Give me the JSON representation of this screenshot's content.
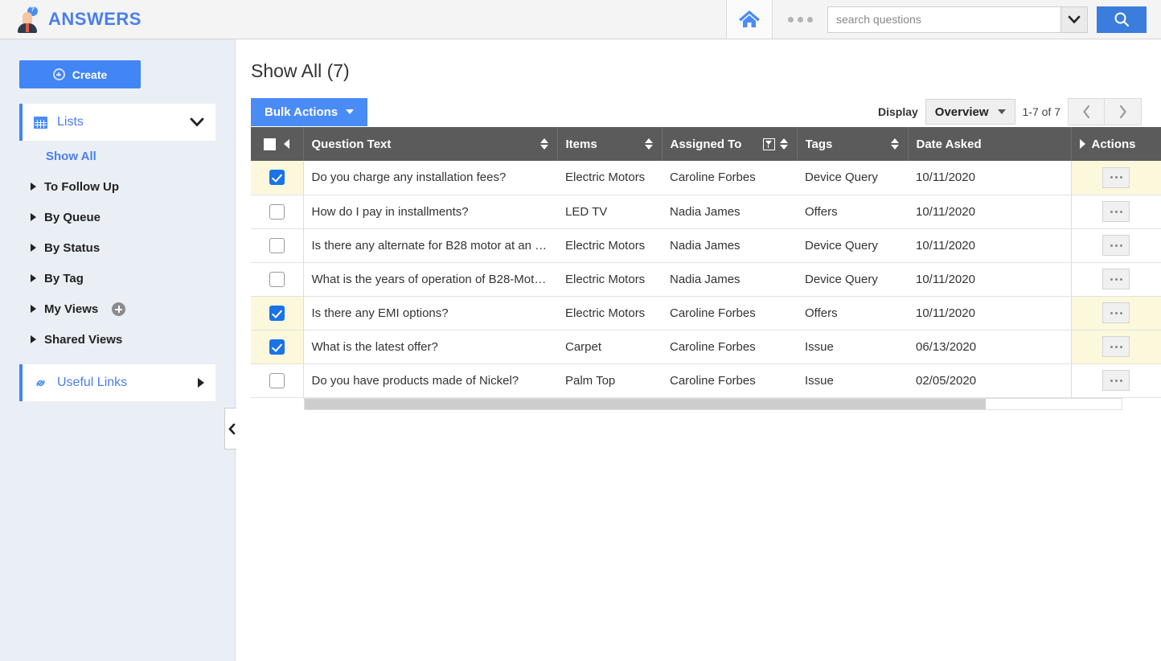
{
  "app": {
    "brand": "ANSWERS",
    "logo_icon": "person-question-icon"
  },
  "topbar": {
    "home_icon": "home-icon",
    "more_icon": "ellipsis-icon",
    "search": {
      "placeholder": "search questions",
      "value": "",
      "dropdown_icon": "chevron-down-icon",
      "submit_icon": "search-icon"
    }
  },
  "sidebar": {
    "create_label": "Create",
    "create_icon": "plus-circle-icon",
    "section": {
      "label": "Lists",
      "icon": "grid-icon",
      "expand_icon": "chevron-down-icon"
    },
    "items": [
      {
        "label": "Show All",
        "current": true,
        "icon": ""
      },
      {
        "label": "To Follow Up",
        "current": false,
        "icon": "chevron-right-icon"
      },
      {
        "label": "By Queue",
        "current": false,
        "icon": "chevron-right-icon"
      },
      {
        "label": "By Status",
        "current": false,
        "icon": "chevron-right-icon"
      },
      {
        "label": "By Tag",
        "current": false,
        "icon": "chevron-right-icon"
      },
      {
        "label": "My Views",
        "current": false,
        "icon": "chevron-right-icon",
        "add_icon": "add-circle-icon"
      },
      {
        "label": "Shared Views",
        "current": false,
        "icon": "chevron-right-icon"
      }
    ],
    "useful_links": {
      "label": "Useful Links",
      "icon": "link-icon",
      "expand_icon": "chevron-right-icon"
    },
    "collapse_icon": "chevron-left-icon"
  },
  "main": {
    "page_title": "Show All (7)",
    "bulk_actions_label": "Bulk Actions",
    "bulk_actions_icon": "caret-down-icon",
    "display_label": "Display",
    "display_value": "Overview",
    "display_icon": "caret-down-icon",
    "range_label": "1-7 of 7",
    "prev_icon": "chevron-left-icon",
    "next_icon": "chevron-right-icon"
  },
  "table": {
    "header_checkbox_icon": "checkbox-icon",
    "header_collapse_icon": "chevron-left-icon",
    "actions_expand_icon": "chevron-right-icon",
    "columns": [
      {
        "label": "Question Text",
        "sort": true,
        "filter": false
      },
      {
        "label": "Items",
        "sort": true,
        "filter": false
      },
      {
        "label": "Assigned To",
        "sort": true,
        "filter": true
      },
      {
        "label": "Tags",
        "sort": true,
        "filter": false
      },
      {
        "label": "Date Asked",
        "sort": false,
        "filter": false
      },
      {
        "label": "Actions",
        "sort": false,
        "filter": false
      }
    ],
    "row_action_icon": "ellipsis-icon",
    "rows": [
      {
        "selected": true,
        "question": "Do you charge any installation fees?",
        "item": "Electric Motors",
        "assigned_to": "Caroline Forbes",
        "tag": "Device Query",
        "date_asked": "10/11/2020"
      },
      {
        "selected": false,
        "question": "How do I pay in installments?",
        "item": "LED TV",
        "assigned_to": "Nadia James",
        "tag": "Offers",
        "date_asked": "10/11/2020"
      },
      {
        "selected": false,
        "question": "Is there any alternate for B28 motor at an e…",
        "item": "Electric Motors",
        "assigned_to": "Nadia James",
        "tag": "Device Query",
        "date_asked": "10/11/2020"
      },
      {
        "selected": false,
        "question": "What is the years of operation of B28-Moto…",
        "item": "Electric Motors",
        "assigned_to": "Nadia James",
        "tag": "Device Query",
        "date_asked": "10/11/2020"
      },
      {
        "selected": true,
        "question": "Is there any EMI options?",
        "item": "Electric Motors",
        "assigned_to": "Caroline Forbes",
        "tag": "Offers",
        "date_asked": "10/11/2020"
      },
      {
        "selected": true,
        "question": "What is the latest offer?",
        "item": "Carpet",
        "assigned_to": "Caroline Forbes",
        "tag": "Issue",
        "date_asked": "06/13/2020"
      },
      {
        "selected": false,
        "question": "Do you have products made of Nickel?",
        "item": "Palm Top",
        "assigned_to": "Caroline Forbes",
        "tag": "Issue",
        "date_asked": "02/05/2020"
      }
    ]
  },
  "colors": {
    "accent_blue": "#4285f4",
    "header_gray": "#5b5b5b",
    "row_selected": "#fbf8dc",
    "sidebar_bg": "#eaeff5"
  }
}
